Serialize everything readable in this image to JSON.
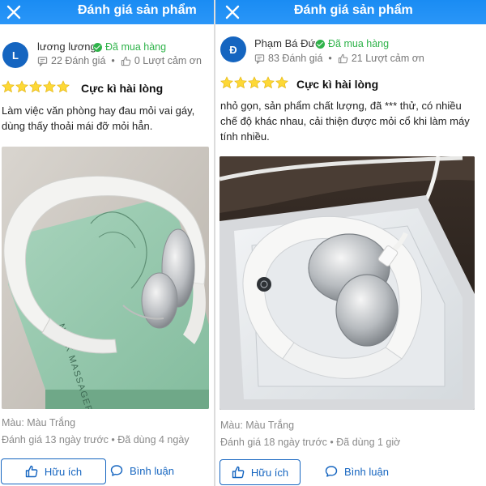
{
  "header": {
    "title": "Đánh giá sản phẩm"
  },
  "reviews": [
    {
      "avatar_letter": "L",
      "user_name": "lương lương",
      "verified_label": "Đã mua hàng",
      "review_count": "22 Đánh giá",
      "thanks_count": "0 Lượt cảm ơn",
      "rating_value": 5,
      "rating_label": "Cực kì hài lòng",
      "text": "Làm việc văn phòng hay đau mỏi vai gáy, dùng thấy thoải mái đỡ mỏi  hẳn.",
      "variant": "Màu: Màu Trắng",
      "posted": "Đánh giá 13 ngày trước",
      "usage": "Đã dùng 4 ngày",
      "helpful_label": "Hữu ích",
      "comment_label": "Bình luận",
      "photo_printed_text": "NECK MASSAGER"
    },
    {
      "avatar_letter": "Đ",
      "user_name": "Phạm Bá Đức",
      "verified_label": "Đã mua hàng",
      "review_count": "83 Đánh giá",
      "thanks_count": "21 Lượt cảm ơn",
      "rating_value": 5,
      "rating_label": "Cực kì hài lòng",
      "text": "nhỏ gọn, sản phẩm chất lượng, đã *** thử, có nhiều chế độ khác nhau, cải thiện được mỏi cổ khi làm máy tính nhiều.",
      "variant": "Màu: Màu Trắng",
      "posted": "Đánh giá 18 ngày trước",
      "usage": "Đã dùng 1 giờ",
      "helpful_label": "Hữu ích",
      "comment_label": "Bình luận"
    }
  ],
  "colors": {
    "header_blue": "#1e90ff",
    "verified_green": "#2fb34a",
    "star_yellow": "#fdd836",
    "action_blue": "#1565c0"
  },
  "icons": [
    "close-icon",
    "check-icon",
    "review-icon",
    "thumbs-up-icon",
    "star-icon",
    "chat-bubble-icon"
  ]
}
